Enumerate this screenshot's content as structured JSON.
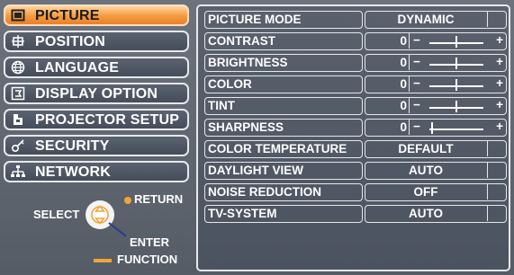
{
  "menu": {
    "items": [
      {
        "label": "PICTURE",
        "icon": "picture-icon",
        "active": true
      },
      {
        "label": "POSITION",
        "icon": "position-icon",
        "active": false
      },
      {
        "label": "LANGUAGE",
        "icon": "globe-icon",
        "active": false
      },
      {
        "label": "DISPLAY OPTION",
        "icon": "display-option-icon",
        "active": false
      },
      {
        "label": "PROJECTOR SETUP",
        "icon": "projector-setup-icon",
        "active": false
      },
      {
        "label": "SECURITY",
        "icon": "key-icon",
        "active": false
      },
      {
        "label": "NETWORK",
        "icon": "network-icon",
        "active": false
      }
    ]
  },
  "help": {
    "return_label": "RETURN",
    "select_label": "SELECT",
    "enter_label": "ENTER",
    "function_label": "FUNCTION",
    "colors": {
      "return_dot": "#f2a33a",
      "function_bar": "#f2a33a",
      "button": "#f2a33a"
    }
  },
  "settings": [
    {
      "label": "PICTURE MODE",
      "type": "text",
      "value": "DYNAMIC"
    },
    {
      "label": "CONTRAST",
      "type": "slider",
      "value": "0",
      "level": 0.5
    },
    {
      "label": "BRIGHTNESS",
      "type": "slider",
      "value": "0",
      "level": 0.5
    },
    {
      "label": "COLOR",
      "type": "slider",
      "value": "0",
      "level": 0.5
    },
    {
      "label": "TINT",
      "type": "slider",
      "value": "0",
      "level": 0.5
    },
    {
      "label": "SHARPNESS",
      "type": "slider",
      "value": "0",
      "level": 0.05
    },
    {
      "label": "COLOR TEMPERATURE",
      "type": "text",
      "value": "DEFAULT"
    },
    {
      "label": "DAYLIGHT VIEW",
      "type": "text",
      "value": "AUTO"
    },
    {
      "label": "NOISE REDUCTION",
      "type": "text",
      "value": "OFF"
    },
    {
      "label": "TV-SYSTEM",
      "type": "text",
      "value": "AUTO"
    }
  ],
  "slider_glyphs": {
    "minus": "−",
    "plus": "+"
  }
}
